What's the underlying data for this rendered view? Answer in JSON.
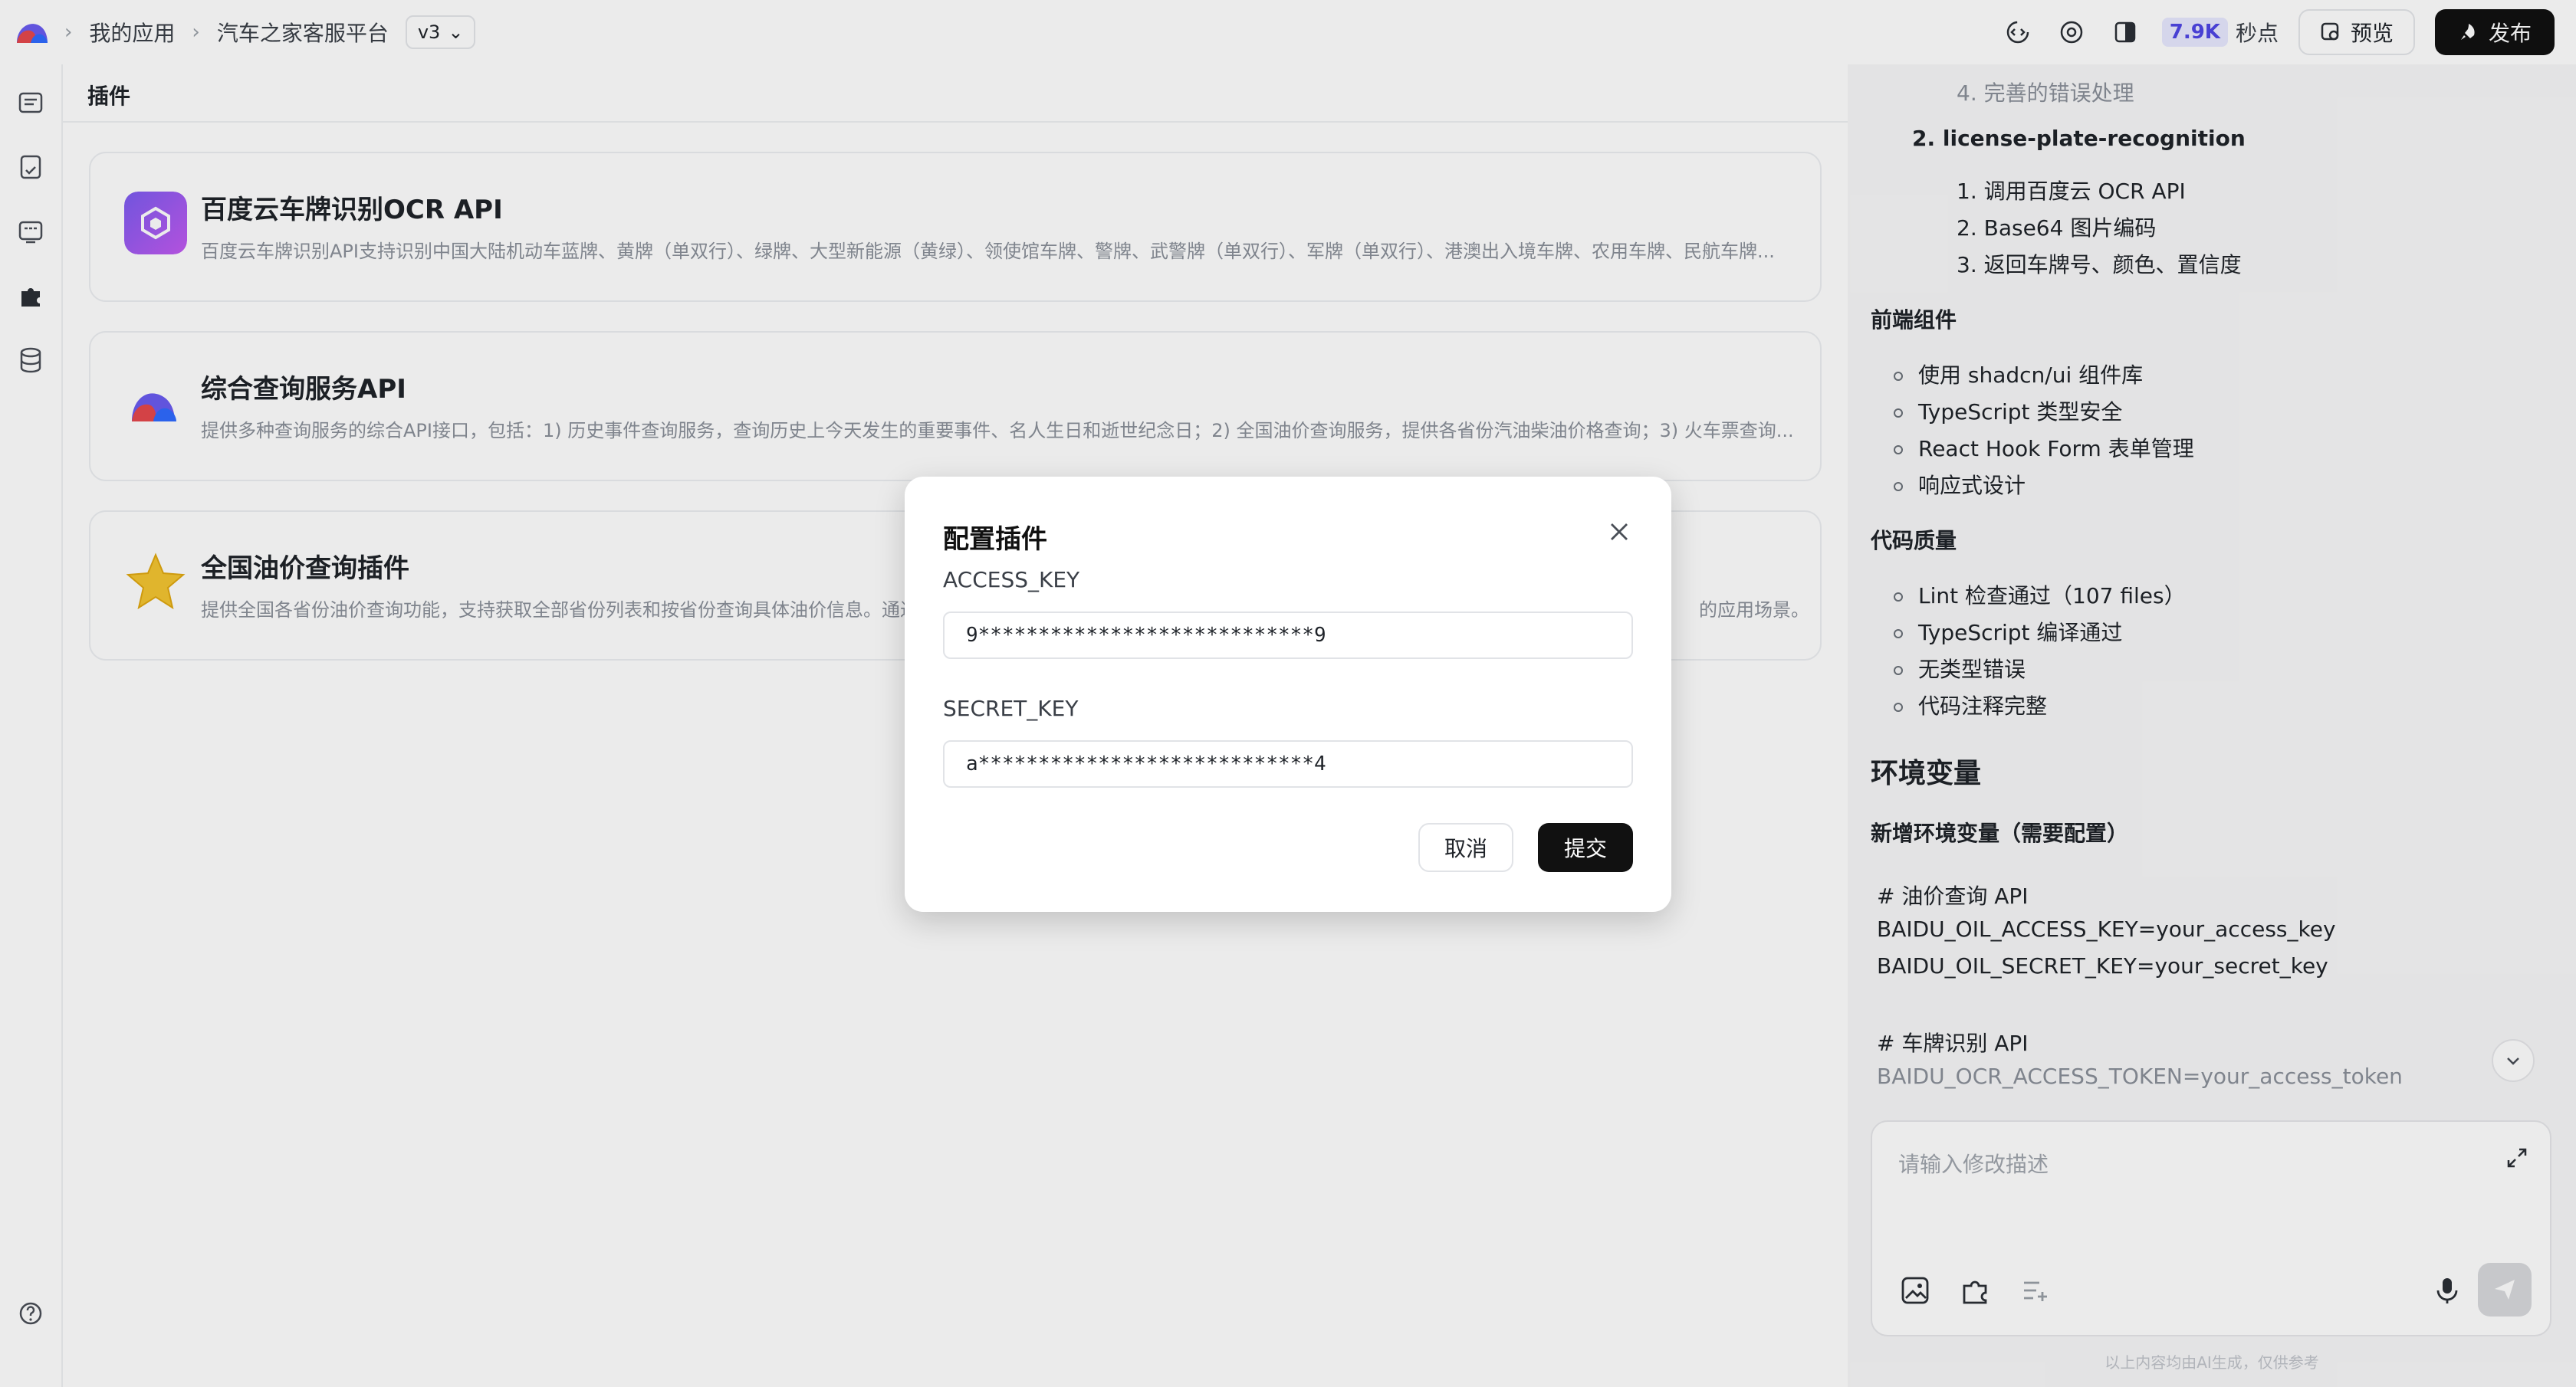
{
  "breadcrumb": {
    "my_apps": "我的应用",
    "app_name": "汽车之家客服平台",
    "version": "v3"
  },
  "topbar": {
    "points_value": "7.9K",
    "points_label": "秒点",
    "preview_label": "预览",
    "publish_label": "发布"
  },
  "main": {
    "section_title": "插件",
    "plugins": [
      {
        "name": "百度云车牌识别OCR API",
        "desc": "百度云车牌识别API支持识别中国大陆机动车蓝牌、黄牌（单双行）、绿牌、大型新能源（黄绿）、领使馆车牌、警牌、武警牌（单双行）、军牌（单双行）、港澳出入境车牌、农用车牌、民航车牌..."
      },
      {
        "name": "综合查询服务API",
        "desc": "提供多种查询服务的综合API接口，包括：1) 历史事件查询服务，查询历史上今天发生的重要事件、名人生日和逝世纪念日；2) 全国油价查询服务，提供各省份汽油柴油价格查询；3) 火车票查询..."
      },
      {
        "name": "全国油价查询插件",
        "desc": "提供全国各省份油价查询功能，支持获取全部省份列表和按省份查询具体油价信息。通过...",
        "desc_tail": "的应用场景。"
      }
    ]
  },
  "right_panel": {
    "l1": "4. 完善的错误处理",
    "l2": "2. license-plate-recognition",
    "l3": "1. 调用百度云 OCR API",
    "l4": "2. Base64 图片编码",
    "l5": "3. 返回车牌号、颜色、置信度",
    "frontend_heading": "前端组件",
    "frontend_items": [
      "使用 shadcn/ui 组件库",
      "TypeScript 类型安全",
      "React Hook Form 表单管理",
      "响应式设计"
    ],
    "quality_heading": "代码质量",
    "quality_items": [
      "Lint 检查通过（107 files）",
      "TypeScript 编译通过",
      "无类型错误",
      "代码注释完整"
    ],
    "env_heading": "环境变量",
    "env_subheading": "新增环境变量（需要配置）",
    "code1": "# 油价查询 API",
    "code2": "BAIDU_OIL_ACCESS_KEY=your_access_key",
    "code3": "BAIDU_OIL_SECRET_KEY=your_secret_key",
    "code4": "# 车牌识别 API",
    "code5": "BAIDU_OCR_ACCESS_TOKEN=your_access_token",
    "chat_placeholder": "请输入修改描述",
    "footnote": "以上内容均由AI生成，仅供参考"
  },
  "modal": {
    "title": "配置插件",
    "access_key_label": "ACCESS_KEY",
    "access_key_value": "9****************************9",
    "secret_key_label": "SECRET_KEY",
    "secret_key_value": "a****************************4",
    "cancel_label": "取消",
    "submit_label": "提交"
  },
  "colors": {
    "accent": "#4f46e5",
    "primary_button": "#111111"
  }
}
